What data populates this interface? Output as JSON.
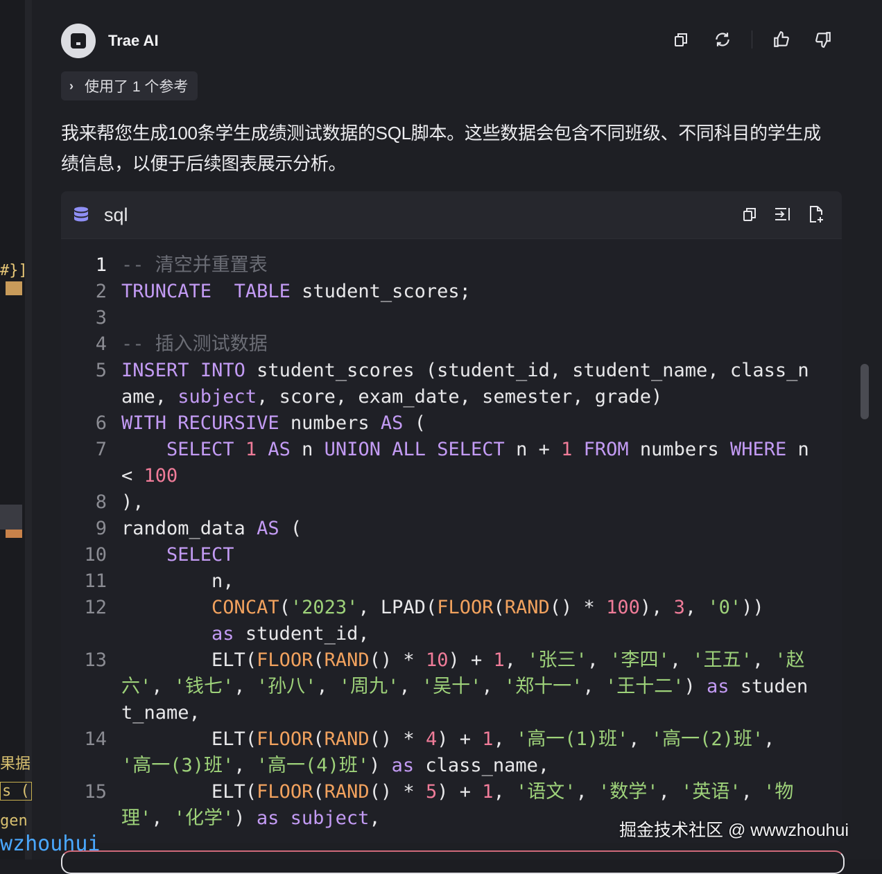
{
  "sidebar_fragments": [
    "#}]",
    "果据",
    "s (",
    "gen",
    "wzhouhui"
  ],
  "agent": {
    "name": "Trae AI"
  },
  "actions": {
    "copy": "copy-icon",
    "regenerate": "refresh-icon",
    "like": "thumbs-up-icon",
    "dislike": "thumbs-down-icon"
  },
  "references": {
    "label": "使用了 1 个参考"
  },
  "intro_text": "我来帮您生成100条学生成绩测试数据的SQL脚本。这些数据会包含不同班级、不同科目的学生成绩信息，以便于后续图表展示分析。",
  "code": {
    "language": "sql",
    "icons": [
      "database-icon",
      "copy-icon",
      "insert-icon",
      "new-file-icon"
    ],
    "lines": [
      {
        "n": "1",
        "tokens": [
          [
            "cm",
            "-- 清空并重置表"
          ]
        ]
      },
      {
        "n": "2",
        "tokens": [
          [
            "kw",
            "TRUNCATE"
          ],
          [
            "",
            "  "
          ],
          [
            "kw",
            "TABLE"
          ],
          [
            "",
            " student_scores;"
          ]
        ]
      },
      {
        "n": "3",
        "tokens": []
      },
      {
        "n": "4",
        "tokens": [
          [
            "cm",
            "-- 插入测试数据"
          ]
        ]
      },
      {
        "n": "5",
        "tokens": [
          [
            "kw",
            "INSERT"
          ],
          [
            "",
            " "
          ],
          [
            "kw",
            "INTO"
          ],
          [
            "",
            " student_scores (student_id, student_name, class_name, "
          ],
          [
            "kw",
            "subject"
          ],
          [
            "",
            ", score, exam_date, semester, grade)"
          ]
        ]
      },
      {
        "n": "6",
        "tokens": [
          [
            "kw",
            "WITH"
          ],
          [
            "",
            " "
          ],
          [
            "kw",
            "RECURSIVE"
          ],
          [
            "",
            " numbers "
          ],
          [
            "kw",
            "AS"
          ],
          [
            "",
            " ("
          ]
        ]
      },
      {
        "n": "7",
        "tokens": [
          [
            "",
            "    "
          ],
          [
            "kw",
            "SELECT"
          ],
          [
            "",
            " "
          ],
          [
            "num",
            "1"
          ],
          [
            "",
            " "
          ],
          [
            "kw",
            "AS"
          ],
          [
            "",
            " n "
          ],
          [
            "kw",
            "UNION"
          ],
          [
            "",
            " "
          ],
          [
            "kw",
            "ALL"
          ],
          [
            "",
            " "
          ],
          [
            "kw",
            "SELECT"
          ],
          [
            "",
            " n + "
          ],
          [
            "num",
            "1"
          ],
          [
            "",
            " "
          ],
          [
            "kw",
            "FROM"
          ],
          [
            "",
            " numbers "
          ],
          [
            "kw",
            "WHERE"
          ],
          [
            "",
            " n < "
          ],
          [
            "num",
            "100"
          ]
        ]
      },
      {
        "n": "8",
        "tokens": [
          [
            "",
            "),"
          ]
        ]
      },
      {
        "n": "9",
        "tokens": [
          [
            "",
            "random_data "
          ],
          [
            "kw",
            "AS"
          ],
          [
            "",
            " ("
          ]
        ]
      },
      {
        "n": "10",
        "tokens": [
          [
            "",
            "    "
          ],
          [
            "kw",
            "SELECT"
          ]
        ]
      },
      {
        "n": "11",
        "tokens": [
          [
            "",
            "        n,"
          ]
        ]
      },
      {
        "n": "12",
        "tokens": [
          [
            "",
            "        "
          ],
          [
            "fn",
            "CONCAT"
          ],
          [
            "",
            "("
          ],
          [
            "str",
            "'2023'"
          ],
          [
            "",
            ", LPAD("
          ],
          [
            "fn",
            "FLOOR"
          ],
          [
            "",
            "("
          ],
          [
            "fn",
            "RAND"
          ],
          [
            "",
            "() * "
          ],
          [
            "num",
            "100"
          ],
          [
            "",
            "), "
          ],
          [
            "num",
            "3"
          ],
          [
            "",
            ", "
          ],
          [
            "str",
            "'0'"
          ],
          [
            "",
            "))"
          ],
          [
            "",
            "\n        "
          ],
          [
            "kw",
            "as"
          ],
          [
            "",
            " student_id,"
          ]
        ]
      },
      {
        "n": "13",
        "tokens": [
          [
            "",
            "        ELT("
          ],
          [
            "fn",
            "FLOOR"
          ],
          [
            "",
            "("
          ],
          [
            "fn",
            "RAND"
          ],
          [
            "",
            "() * "
          ],
          [
            "num",
            "10"
          ],
          [
            "",
            ") + "
          ],
          [
            "num",
            "1"
          ],
          [
            "",
            ", "
          ],
          [
            "str",
            "'张三'"
          ],
          [
            "",
            ", "
          ],
          [
            "str",
            "'李四'"
          ],
          [
            "",
            ", "
          ],
          [
            "str",
            "'王五'"
          ],
          [
            "",
            ", "
          ],
          [
            "str",
            "'赵六'"
          ],
          [
            "",
            ", "
          ],
          [
            "str",
            "'钱七'"
          ],
          [
            "",
            ", "
          ],
          [
            "str",
            "'孙八'"
          ],
          [
            "",
            ", "
          ],
          [
            "str",
            "'周九'"
          ],
          [
            "",
            ", "
          ],
          [
            "str",
            "'吴十'"
          ],
          [
            "",
            ", "
          ],
          [
            "str",
            "'郑十一'"
          ],
          [
            "",
            ", "
          ],
          [
            "str",
            "'王十二'"
          ],
          [
            "",
            ") "
          ],
          [
            "kw",
            "as"
          ],
          [
            "",
            " student_name,"
          ]
        ]
      },
      {
        "n": "14",
        "tokens": [
          [
            "",
            "        ELT("
          ],
          [
            "fn",
            "FLOOR"
          ],
          [
            "",
            "("
          ],
          [
            "fn",
            "RAND"
          ],
          [
            "",
            "() * "
          ],
          [
            "num",
            "4"
          ],
          [
            "",
            ") + "
          ],
          [
            "num",
            "1"
          ],
          [
            "",
            ", "
          ],
          [
            "str",
            "'高一(1)班'"
          ],
          [
            "",
            ", "
          ],
          [
            "str",
            "'高一(2)班'"
          ],
          [
            "",
            ", "
          ],
          [
            "str",
            "'高一(3)班'"
          ],
          [
            "",
            ", "
          ],
          [
            "str",
            "'高一(4)班'"
          ],
          [
            "",
            ") "
          ],
          [
            "kw",
            "as"
          ],
          [
            "",
            " class_name,"
          ]
        ]
      },
      {
        "n": "15",
        "tokens": [
          [
            "",
            "        ELT("
          ],
          [
            "fn",
            "FLOOR"
          ],
          [
            "",
            "("
          ],
          [
            "fn",
            "RAND"
          ],
          [
            "",
            "() * "
          ],
          [
            "num",
            "5"
          ],
          [
            "",
            ") + "
          ],
          [
            "num",
            "1"
          ],
          [
            "",
            ", "
          ],
          [
            "str",
            "'语文'"
          ],
          [
            "",
            ", "
          ],
          [
            "str",
            "'数学'"
          ],
          [
            "",
            ", "
          ],
          [
            "str",
            "'英语'"
          ],
          [
            "",
            ", "
          ],
          [
            "str",
            "'物理'"
          ],
          [
            "",
            ", "
          ],
          [
            "str",
            "'化学'"
          ],
          [
            "",
            ") "
          ],
          [
            "kw",
            "as"
          ],
          [
            "",
            " "
          ],
          [
            "kw",
            "subject"
          ],
          [
            "",
            ","
          ]
        ]
      }
    ]
  },
  "watermark": "掘金技术社区 @ wwwzhouhui",
  "colors": {
    "keyword": "#c39bf4",
    "function": "#f2a25e",
    "number": "#f07c99",
    "string": "#9ed27a",
    "comment": "#6b6d75"
  }
}
